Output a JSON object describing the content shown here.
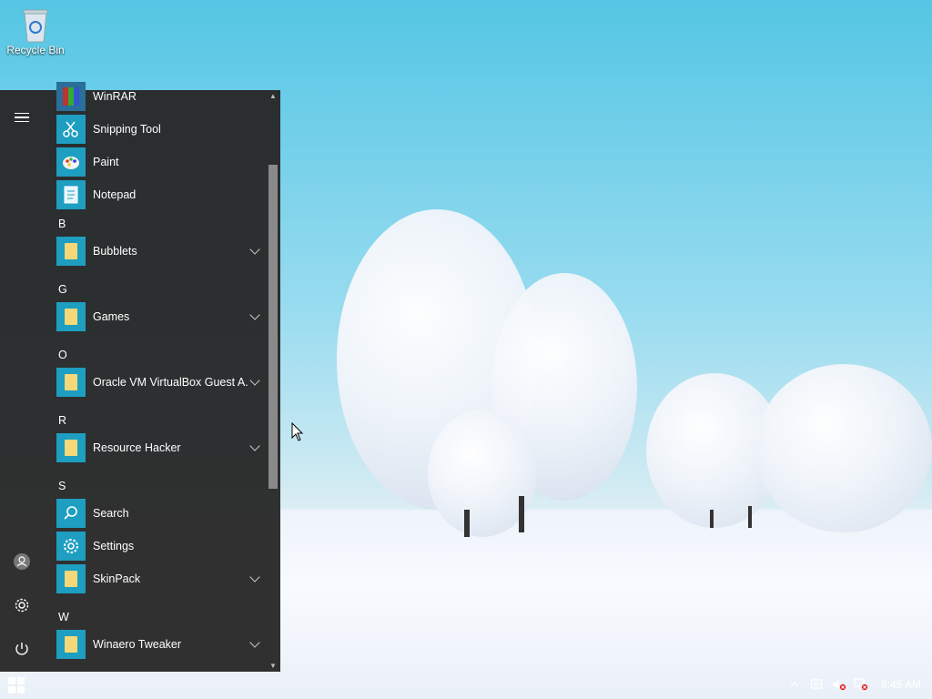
{
  "desktop": {
    "recycle_bin_label": "Recycle Bin"
  },
  "start_menu": {
    "rail": {
      "menu_icon": "hamburger-icon",
      "user_icon": "user-icon",
      "settings_icon": "gear-icon",
      "power_icon": "power-icon"
    },
    "apps": [
      {
        "label": "WinRAR",
        "icon": "winrar-icon"
      },
      {
        "label": "Snipping Tool",
        "icon": "scissors-icon"
      },
      {
        "label": "Paint",
        "icon": "paint-palette-icon"
      },
      {
        "label": "Notepad",
        "icon": "notepad-icon"
      }
    ],
    "groups": [
      {
        "letter": "B",
        "items": [
          {
            "label": "Bubblets",
            "icon": "folder-icon",
            "expandable": true
          }
        ]
      },
      {
        "letter": "G",
        "items": [
          {
            "label": "Games",
            "icon": "folder-icon",
            "expandable": true
          }
        ]
      },
      {
        "letter": "O",
        "items": [
          {
            "label": "Oracle VM VirtualBox Guest A...",
            "icon": "folder-icon",
            "expandable": true
          }
        ]
      },
      {
        "letter": "R",
        "items": [
          {
            "label": "Resource Hacker",
            "icon": "folder-icon",
            "expandable": true
          }
        ]
      },
      {
        "letter": "S",
        "items": [
          {
            "label": "Search",
            "icon": "search-icon",
            "expandable": false
          },
          {
            "label": "Settings",
            "icon": "gear-icon",
            "expandable": false
          },
          {
            "label": "SkinPack",
            "icon": "folder-icon",
            "expandable": true
          }
        ]
      },
      {
        "letter": "W",
        "items": [
          {
            "label": "Winaero Tweaker",
            "icon": "folder-icon",
            "expandable": true
          }
        ]
      }
    ]
  },
  "taskbar": {
    "start_icon": "windows-logo-icon",
    "tray_icons": [
      "chevron-up-icon",
      "action-center-icon",
      "volume-muted-icon",
      "network-disconnected-icon"
    ],
    "clock": "8:45 AM"
  },
  "colors": {
    "menu_bg": "#282828",
    "tile": "#1e9ec0",
    "folder": "#f5d878"
  }
}
